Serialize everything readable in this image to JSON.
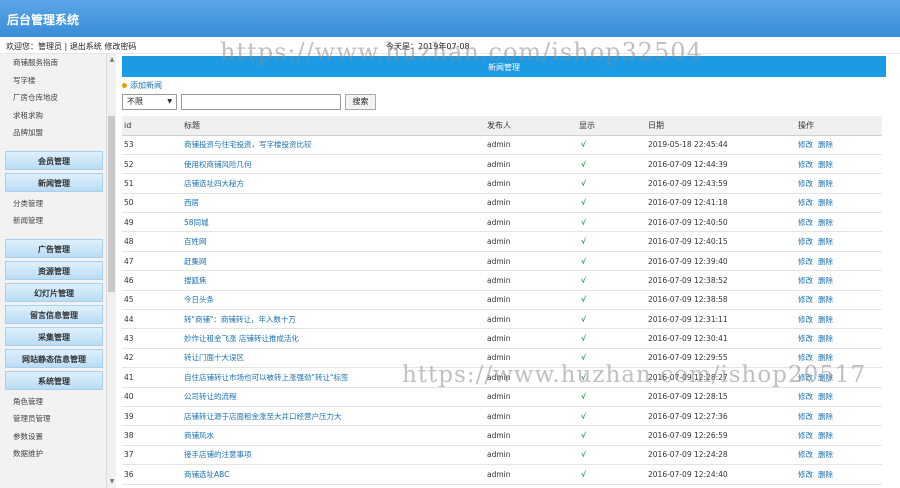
{
  "app": {
    "title": "后台管理系统"
  },
  "infobar": {
    "user_text": "欢迎您：管理员 | 退出系统 修改密码",
    "date_text": "今天是：2019年07-08"
  },
  "sidebar": {
    "top_items": [
      "商铺服务指南",
      "写字楼",
      "厂房仓库地皮",
      "求租求购",
      "品牌加盟"
    ],
    "groups": [
      {
        "header": "会员管理",
        "items": []
      },
      {
        "header": "新闻管理",
        "items": [
          "分类管理",
          "新闻管理"
        ]
      },
      {
        "header": "广告管理",
        "items": []
      },
      {
        "header": "资源管理",
        "items": []
      },
      {
        "header": "幻灯片管理",
        "items": []
      },
      {
        "header": "留言信息管理",
        "items": []
      },
      {
        "header": "采集管理",
        "items": []
      },
      {
        "header": "网站静态信息管理",
        "items": []
      },
      {
        "header": "系统管理",
        "items": [
          "角色管理",
          "管理员管理",
          "参数设置",
          "数据维护"
        ]
      }
    ]
  },
  "panel": {
    "title": "新闻管理",
    "add_link": "添加新闻",
    "filter_value": "不限",
    "search_button": "搜索"
  },
  "table": {
    "headers": [
      "id",
      "标题",
      "发布人",
      "显示",
      "日期",
      "操作"
    ],
    "edit_label": "修改",
    "delete_label": "删除",
    "rows": [
      {
        "id": "53",
        "title": "商铺投资与住宅投资，写字楼投资比较",
        "author": "admin",
        "show": "√",
        "date": "2019-05-18 22:45:44"
      },
      {
        "id": "52",
        "title": "使用权商铺风险几何",
        "author": "admin",
        "show": "√",
        "date": "2016-07-09 12:44:39"
      },
      {
        "id": "51",
        "title": "店铺选址四大秘方",
        "author": "admin",
        "show": "√",
        "date": "2016-07-09 12:43:59"
      },
      {
        "id": "50",
        "title": "西居",
        "author": "admin",
        "show": "√",
        "date": "2016-07-09 12:41:18"
      },
      {
        "id": "49",
        "title": "58同城",
        "author": "admin",
        "show": "√",
        "date": "2016-07-09 12:40:50"
      },
      {
        "id": "48",
        "title": "百姓网",
        "author": "admin",
        "show": "√",
        "date": "2016-07-09 12:40:15"
      },
      {
        "id": "47",
        "title": "赶集网",
        "author": "admin",
        "show": "√",
        "date": "2016-07-09 12:39:40"
      },
      {
        "id": "46",
        "title": "搜狐焦",
        "author": "admin",
        "show": "√",
        "date": "2016-07-09 12:38:52"
      },
      {
        "id": "45",
        "title": "今日头条",
        "author": "admin",
        "show": "√",
        "date": "2016-07-09 12:38:58"
      },
      {
        "id": "44",
        "title": "转\"商铺\"：商铺转让，年入数十万",
        "author": "admin",
        "show": "√",
        "date": "2016-07-09 12:31:11"
      },
      {
        "id": "43",
        "title": "妙作让租金飞涨 店铺转让推成活化",
        "author": "admin",
        "show": "√",
        "date": "2016-07-09 12:30:41"
      },
      {
        "id": "42",
        "title": "转让门面十大误区",
        "author": "admin",
        "show": "√",
        "date": "2016-07-09 12:29:55"
      },
      {
        "id": "41",
        "title": "自住店铺转让市场也可以被转上涨强劲\"转让\"标签",
        "author": "admin",
        "show": "√",
        "date": "2016-07-09 12:28:27"
      },
      {
        "id": "40",
        "title": "公司转让的流程",
        "author": "admin",
        "show": "√",
        "date": "2016-07-09 12:28:15"
      },
      {
        "id": "39",
        "title": "店铺转让源于店面租金涨至大井口经营户压力大",
        "author": "admin",
        "show": "√",
        "date": "2016-07-09 12:27:36"
      },
      {
        "id": "38",
        "title": "商铺风水",
        "author": "admin",
        "show": "√",
        "date": "2016-07-09 12:26:59"
      },
      {
        "id": "37",
        "title": "接手店铺的注意事项",
        "author": "admin",
        "show": "√",
        "date": "2016-07-09 12:24:28"
      },
      {
        "id": "36",
        "title": "商铺选址ABC",
        "author": "admin",
        "show": "√",
        "date": "2016-07-09 12:24:40"
      }
    ]
  },
  "watermarks": [
    "https://www.huzhan.com/ishop32504",
    "https://www.huzhan.com/ishop20517"
  ]
}
